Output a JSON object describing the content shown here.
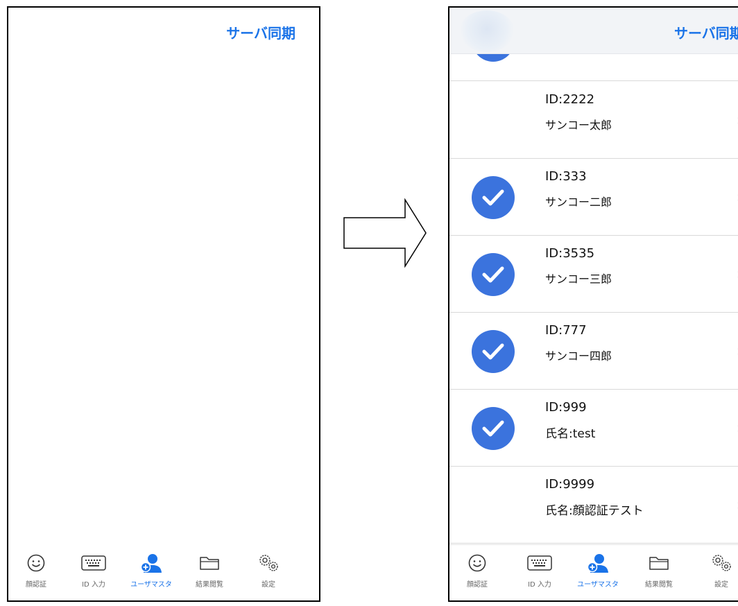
{
  "header": {
    "sync_label": "サーバ同期"
  },
  "users": [
    {
      "id": "ID:2222",
      "name": "サンコー太郎",
      "checked": false
    },
    {
      "id": "ID:333",
      "name": "サンコー二郎",
      "checked": true
    },
    {
      "id": "ID:3535",
      "name": "サンコー三郎",
      "checked": true
    },
    {
      "id": "ID:777",
      "name": "サンコー四郎",
      "checked": true
    },
    {
      "id": "ID:999",
      "name": "氏名:test",
      "checked": true
    },
    {
      "id": "ID:9999",
      "name": "氏名:顔認証テスト",
      "checked": false
    }
  ],
  "tabs": [
    {
      "label": "顔認証",
      "icon": "smiley-face-icon"
    },
    {
      "label": "ID 入力",
      "icon": "keyboard-icon"
    },
    {
      "label": "ユーザマスタ",
      "icon": "add-user-icon",
      "active": true
    },
    {
      "label": "結果閲覧",
      "icon": "folder-icon"
    },
    {
      "label": "設定",
      "icon": "gears-icon"
    }
  ],
  "colors": {
    "accent": "#1a73e8",
    "check": "#3b73dd",
    "inactive_tab": "#666666"
  }
}
